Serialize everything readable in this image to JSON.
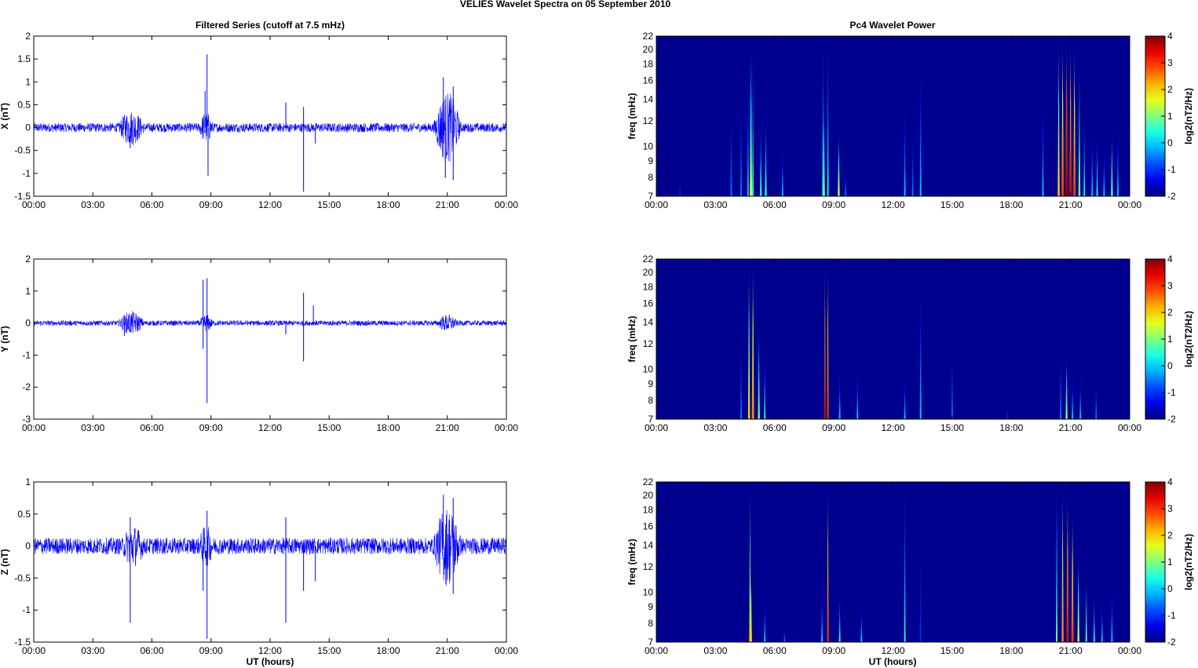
{
  "figure_title": "VELIES Wavelet Spectra on 05 September 2010",
  "left_title": "Filtered Series (cutoff at 7.5 mHz)",
  "right_title": "Pc4 Wavelet Power",
  "xlabel": "UT (hours)",
  "freq_label": "freq (mHz)",
  "colorbar_label": "log2(nT2/Hz)",
  "colors": {
    "trace": "#0000FF",
    "background": "#00008F"
  },
  "chart_data": [
    {
      "type": "line",
      "name": "X",
      "ylabel": "X (nT)",
      "ylim": [
        -1.5,
        2
      ],
      "yticks": [
        "-1.5",
        "-1",
        "-0.5",
        "0",
        "0.5",
        "1",
        "1.5",
        "2"
      ],
      "ytick_values": [
        -1.5,
        -1,
        -0.5,
        0,
        0.5,
        1,
        1.5,
        2
      ],
      "xticks": [
        "00:00",
        "03:00",
        "06:00",
        "09:00",
        "12:00",
        "15:00",
        "18:00",
        "21:00",
        "00:00"
      ],
      "xlim_hours": [
        0,
        24
      ],
      "noise_amplitude": 0.1,
      "bursts": [
        [
          4.3,
          5.6,
          0.3
        ],
        [
          8.4,
          9.1,
          0.25
        ],
        [
          20.3,
          21.7,
          0.7
        ]
      ],
      "spikes": [
        [
          4.9,
          -0.45
        ],
        [
          8.7,
          0.8
        ],
        [
          8.8,
          1.6
        ],
        [
          8.85,
          -1.05
        ],
        [
          12.8,
          0.55
        ],
        [
          13.7,
          -1.4
        ],
        [
          13.7,
          0.45
        ],
        [
          14.3,
          -0.35
        ],
        [
          20.8,
          1.1
        ],
        [
          20.9,
          -1.1
        ],
        [
          21.3,
          0.9
        ],
        [
          21.3,
          -1.15
        ]
      ]
    },
    {
      "type": "line",
      "name": "Y",
      "ylabel": "Y (nT)",
      "ylim": [
        -3,
        2
      ],
      "yticks": [
        "-3",
        "-2",
        "-1",
        "0",
        "1",
        "2"
      ],
      "ytick_values": [
        -3,
        -2,
        -1,
        0,
        1,
        2
      ],
      "xticks": [
        "00:00",
        "03:00",
        "06:00",
        "09:00",
        "12:00",
        "15:00",
        "18:00",
        "21:00",
        "00:00"
      ],
      "xlim_hours": [
        0,
        24
      ],
      "noise_amplitude": 0.08,
      "bursts": [
        [
          4.3,
          5.6,
          0.3
        ],
        [
          8.4,
          9.1,
          0.2
        ],
        [
          20.5,
          21.5,
          0.2
        ]
      ],
      "spikes": [
        [
          4.6,
          -0.4
        ],
        [
          8.6,
          1.35
        ],
        [
          8.6,
          -0.8
        ],
        [
          8.8,
          1.4
        ],
        [
          8.8,
          -2.5
        ],
        [
          12.8,
          -0.35
        ],
        [
          13.7,
          0.95
        ],
        [
          13.7,
          -1.2
        ],
        [
          14.2,
          0.55
        ]
      ]
    },
    {
      "type": "line",
      "name": "Z",
      "ylabel": "Z (nT)",
      "ylim": [
        -1.5,
        1
      ],
      "yticks": [
        "-1.5",
        "-1",
        "-0.5",
        "0",
        "0.5",
        "1"
      ],
      "ytick_values": [
        -1.5,
        -1,
        -0.5,
        0,
        0.5,
        1
      ],
      "xticks": [
        "00:00",
        "03:00",
        "06:00",
        "09:00",
        "12:00",
        "15:00",
        "18:00",
        "21:00",
        "00:00"
      ],
      "xlim_hours": [
        0,
        24
      ],
      "noise_amplitude": 0.13,
      "bursts": [
        [
          4.5,
          5.6,
          0.2
        ],
        [
          8.4,
          9.1,
          0.2
        ],
        [
          20.3,
          21.7,
          0.5
        ]
      ],
      "spikes": [
        [
          4.9,
          -1.2
        ],
        [
          4.9,
          0.45
        ],
        [
          8.6,
          -0.7
        ],
        [
          8.8,
          -1.45
        ],
        [
          8.8,
          0.55
        ],
        [
          12.8,
          -1.2
        ],
        [
          12.8,
          0.45
        ],
        [
          13.7,
          -0.7
        ],
        [
          14.3,
          -0.55
        ],
        [
          20.8,
          0.8
        ],
        [
          21.3,
          0.75
        ],
        [
          21.3,
          -0.75
        ]
      ]
    },
    {
      "type": "heatmap",
      "name": "X power",
      "ylabel": "freq (mHz)",
      "yscale": "log",
      "ylim": [
        7,
        22
      ],
      "yticks": [
        "7",
        "8",
        "9",
        "10",
        "12",
        "14",
        "16",
        "18",
        "20",
        "22"
      ],
      "ytick_values": [
        7,
        8,
        9,
        10,
        12,
        14,
        16,
        18,
        20,
        22
      ],
      "xticks": [
        "00:00",
        "03:00",
        "06:00",
        "09:00",
        "12:00",
        "15:00",
        "18:00",
        "21:00",
        "00:00"
      ],
      "xlim_hours": [
        0,
        24
      ],
      "clim": [
        -2,
        4
      ],
      "cticks": [
        "4",
        "3",
        "2",
        "1",
        "0",
        "-1",
        "-2"
      ],
      "ctick_values": [
        4,
        3,
        2,
        1,
        0,
        -1,
        -2
      ],
      "events_hours_power_fmax_width": [
        [
          1.2,
          -1,
          8.5,
          0.05
        ],
        [
          3.8,
          -0.5,
          16,
          0.06
        ],
        [
          4.3,
          -0.5,
          18,
          0.06
        ],
        [
          4.65,
          0,
          19,
          0.07
        ],
        [
          4.8,
          1.5,
          21,
          0.12
        ],
        [
          4.9,
          0.5,
          22,
          0.03
        ],
        [
          5.3,
          0.5,
          12,
          0.1
        ],
        [
          5.55,
          0.6,
          12.5,
          0.1
        ],
        [
          6.4,
          0,
          10.5,
          0.06
        ],
        [
          8.45,
          0.5,
          22,
          0.03
        ],
        [
          8.5,
          1,
          14,
          0.1
        ],
        [
          8.7,
          0.5,
          22,
          0.03
        ],
        [
          9.25,
          1.5,
          11,
          0.1
        ],
        [
          9.6,
          -0.5,
          9,
          0.06
        ],
        [
          12.6,
          0,
          15,
          0.05
        ],
        [
          13,
          -0.5,
          12.5,
          0.05
        ],
        [
          13.4,
          0,
          22,
          0.03
        ],
        [
          19.6,
          0,
          16,
          0.05
        ],
        [
          20.4,
          2,
          22,
          0.1
        ],
        [
          20.6,
          3,
          22,
          0.12
        ],
        [
          20.8,
          4,
          22,
          0.14
        ],
        [
          21.0,
          3.5,
          22,
          0.12
        ],
        [
          21.2,
          3,
          21,
          0.12
        ],
        [
          21.45,
          1,
          18,
          0.1
        ],
        [
          21.7,
          0.5,
          12.5,
          0.08
        ],
        [
          22.1,
          0,
          12,
          0.07
        ],
        [
          22.35,
          0.5,
          11,
          0.08
        ],
        [
          22.7,
          0,
          10.5,
          0.07
        ],
        [
          23.1,
          1,
          11,
          0.1
        ],
        [
          23.4,
          0,
          12.5,
          0.07
        ]
      ]
    },
    {
      "type": "heatmap",
      "name": "Y power",
      "ylabel": "freq (mHz)",
      "yscale": "log",
      "ylim": [
        7,
        22
      ],
      "yticks": [
        "7",
        "8",
        "9",
        "10",
        "12",
        "14",
        "16",
        "18",
        "20",
        "22"
      ],
      "ytick_values": [
        7,
        8,
        9,
        10,
        12,
        14,
        16,
        18,
        20,
        22
      ],
      "xticks": [
        "00:00",
        "03:00",
        "06:00",
        "09:00",
        "12:00",
        "15:00",
        "18:00",
        "21:00",
        "00:00"
      ],
      "xlim_hours": [
        0,
        24
      ],
      "clim": [
        -2,
        4
      ],
      "cticks": [
        "4",
        "3",
        "2",
        "1",
        "0",
        "-1",
        "-2"
      ],
      "ctick_values": [
        4,
        3,
        2,
        1,
        0,
        -1,
        -2
      ],
      "events_hours_power_fmax_width": [
        [
          4.3,
          -0.5,
          15,
          0.06
        ],
        [
          4.7,
          2,
          22,
          0.1
        ],
        [
          4.9,
          2.5,
          22,
          0.12
        ],
        [
          5.2,
          1,
          14,
          0.1
        ],
        [
          5.5,
          0.6,
          11,
          0.08
        ],
        [
          8.55,
          3.5,
          22,
          0.04
        ],
        [
          8.7,
          3,
          22,
          0.04
        ],
        [
          9.3,
          0,
          10.5,
          0.06
        ],
        [
          10.2,
          0,
          10.5,
          0.07
        ],
        [
          12.6,
          0,
          10,
          0.05
        ],
        [
          13.4,
          0,
          22,
          0.03
        ],
        [
          15,
          -0.5,
          14,
          0.05
        ],
        [
          17.8,
          -1,
          8,
          0.05
        ],
        [
          20.5,
          -0.5,
          14,
          0.06
        ],
        [
          20.8,
          1.2,
          11,
          0.1
        ],
        [
          21.1,
          0,
          10,
          0.07
        ],
        [
          21.5,
          0,
          10,
          0.06
        ],
        [
          22.3,
          -0.5,
          10,
          0.06
        ]
      ]
    },
    {
      "type": "heatmap",
      "name": "Z power",
      "ylabel": "freq (mHz)",
      "yscale": "log",
      "ylim": [
        7,
        22
      ],
      "yticks": [
        "7",
        "8",
        "9",
        "10",
        "12",
        "14",
        "16",
        "18",
        "20",
        "22"
      ],
      "ytick_values": [
        7,
        8,
        9,
        10,
        12,
        14,
        16,
        18,
        20,
        22
      ],
      "xticks": [
        "00:00",
        "03:00",
        "06:00",
        "09:00",
        "12:00",
        "15:00",
        "18:00",
        "21:00",
        "00:00"
      ],
      "xlim_hours": [
        0,
        24
      ],
      "clim": [
        -2,
        4
      ],
      "cticks": [
        "4",
        "3",
        "2",
        "1",
        "0",
        "-1",
        "-2"
      ],
      "ctick_values": [
        4,
        3,
        2,
        1,
        0,
        -1,
        -2
      ],
      "events_hours_power_fmax_width": [
        [
          4.75,
          2,
          22,
          0.05
        ],
        [
          4.8,
          2,
          12,
          0.1
        ],
        [
          5.5,
          0,
          10,
          0.07
        ],
        [
          6.5,
          -0.5,
          8,
          0.05
        ],
        [
          8.4,
          0,
          11,
          0.07
        ],
        [
          8.7,
          3,
          22,
          0.04
        ],
        [
          9.3,
          0.5,
          10,
          0.08
        ],
        [
          10.4,
          0,
          9.5,
          0.06
        ],
        [
          12.6,
          0.5,
          22,
          0.04
        ],
        [
          13.4,
          -1,
          22,
          0.03
        ],
        [
          20.3,
          1,
          22,
          0.08
        ],
        [
          20.6,
          2.5,
          22,
          0.1
        ],
        [
          20.85,
          3.5,
          21,
          0.12
        ],
        [
          21.1,
          3,
          18,
          0.12
        ],
        [
          21.4,
          1.5,
          13,
          0.1
        ],
        [
          21.8,
          1,
          11,
          0.08
        ],
        [
          22.2,
          0.5,
          10,
          0.07
        ],
        [
          22.6,
          0,
          10,
          0.06
        ],
        [
          23.1,
          0,
          11,
          0.06
        ]
      ]
    }
  ]
}
